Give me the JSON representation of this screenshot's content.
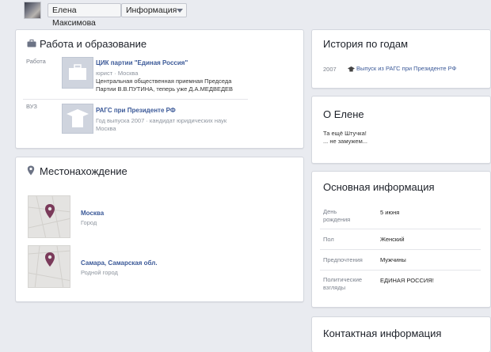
{
  "breadcrumb": {
    "name": "Елена Максимова",
    "section": "Информация"
  },
  "work": {
    "title": "Работа и образование",
    "work_label": "Работа",
    "job": {
      "org": "ЦИК партии \"Единая Россия\"",
      "meta": "юрист · Москва",
      "desc1": "Центральная общественная приемная Председа",
      "desc2": "Партии В.В.ПУТИНА, теперь уже Д.А.МЕДВЕДЕВ"
    },
    "edu_label": "ВУЗ",
    "edu": {
      "org": "РАГС при Президенте РФ",
      "meta": "Год выпуска 2007 · кандидат юридических наук",
      "city": "Москва"
    }
  },
  "location": {
    "title": "Местонахождение",
    "places": [
      {
        "name": "Москва",
        "type": "Город"
      },
      {
        "name": "Самара, Самарская обл.",
        "type": "Родной город"
      }
    ]
  },
  "history": {
    "title": "История по годам",
    "year": "2007",
    "event": "Выпуск из РАГС при Президенте РФ"
  },
  "about": {
    "title": "О Елене",
    "line1": "Та ещё Штучка!",
    "line2": "... не замужем..."
  },
  "basic": {
    "title": "Основная информация",
    "rows": [
      {
        "label1": "День",
        "label2": "рождения",
        "value": "5 июня"
      },
      {
        "label1": "Пол",
        "label2": "",
        "value": "Женский"
      },
      {
        "label1": "Предпочтения",
        "label2": "",
        "value": "Мужчины"
      },
      {
        "label1": "Политические",
        "label2": "взгляды",
        "value": "ЕДИНАЯ РОССИЯ!"
      }
    ]
  },
  "contact": {
    "title": "Контактная информация"
  },
  "colors": {
    "link": "#3b5998",
    "background": "#e9ebf0",
    "pin": "#7a3a5a"
  }
}
